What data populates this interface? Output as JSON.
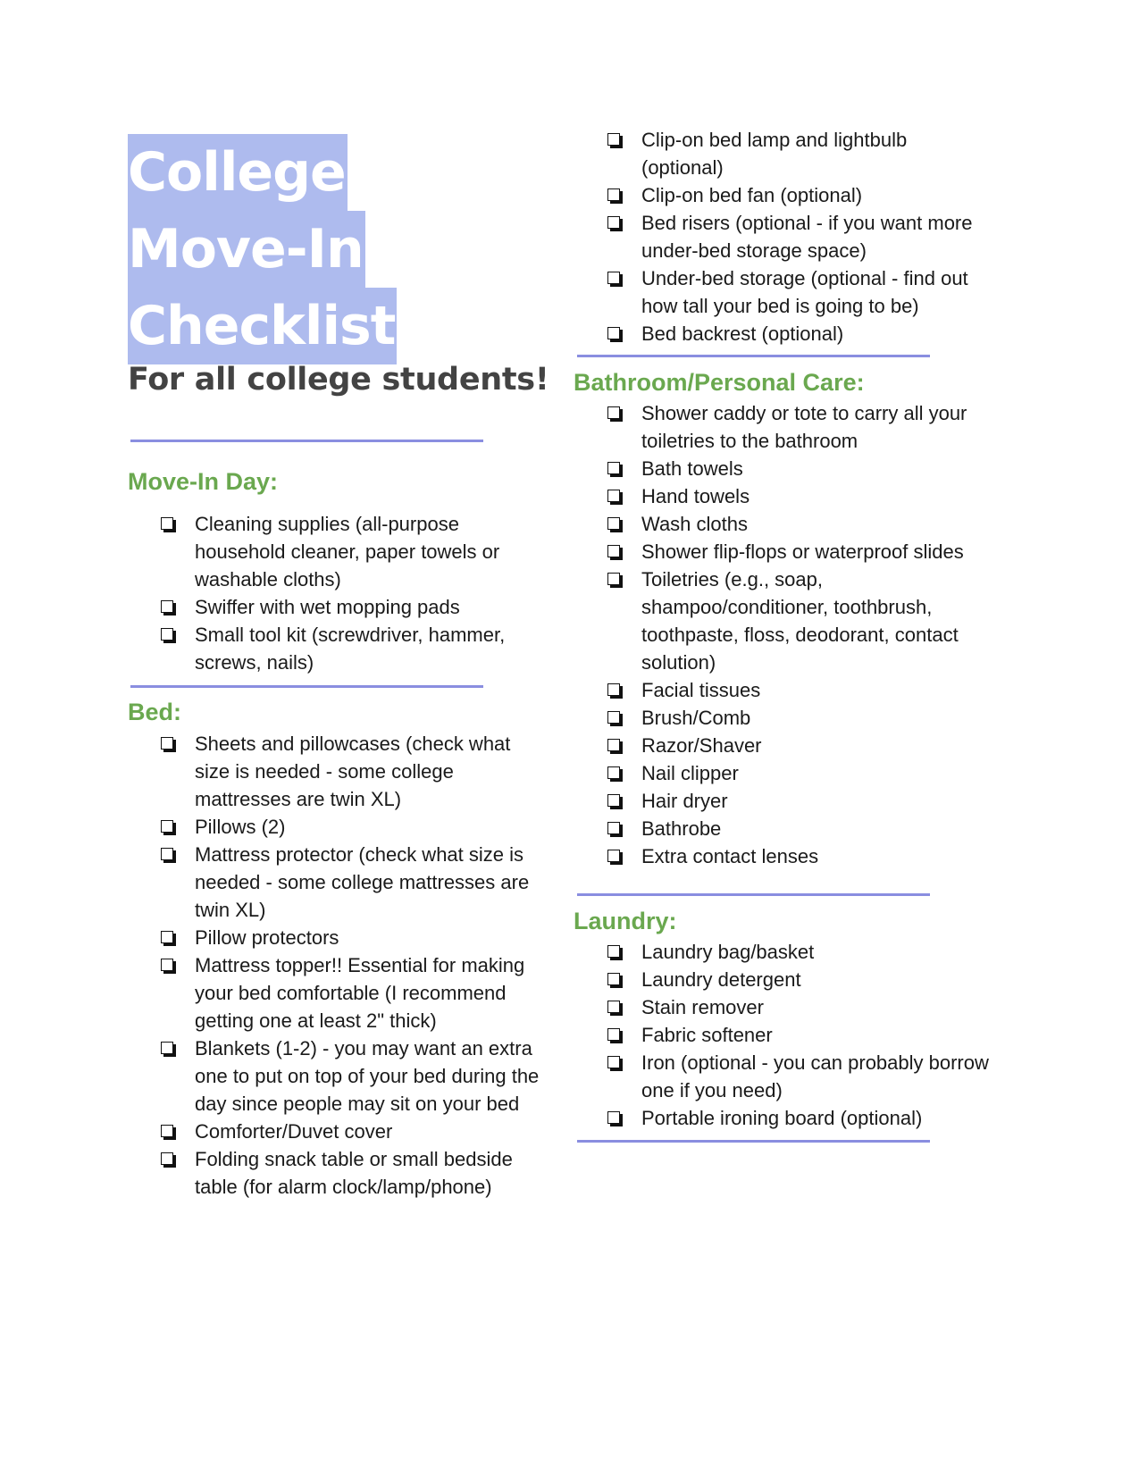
{
  "title": {
    "lines": [
      "College",
      "Move-In",
      "Checklist"
    ],
    "subtitle": "For all college students!"
  },
  "colors": {
    "heading": "#6aa84f",
    "title_highlight": "#aebbee",
    "divider": "#8a8ee0"
  },
  "icons": {
    "bullet": "checkbox-icon"
  },
  "sections": {
    "move_in": {
      "heading": "Move-In Day:",
      "items": [
        "Cleaning supplies (all-purpose household cleaner, paper towels or washable cloths)",
        "Swiffer with wet mopping pads",
        "Small tool kit (screwdriver, hammer, screws, nails)"
      ]
    },
    "bed": {
      "heading": "Bed:",
      "items": [
        "Sheets and pillowcases (check what size is needed - some college mattresses are twin XL)",
        "Pillows (2)",
        "Mattress protector (check what size is needed - some college mattresses are twin XL)",
        "Pillow protectors",
        "Mattress topper!! Essential for making your bed comfortable (I recommend getting one at least 2\" thick)",
        "Blankets (1-2) - you may want an extra one to put on top of your bed during the day since people may sit on your bed",
        "Comforter/Duvet cover",
        "Folding snack table or small bedside table (for alarm clock/lamp/phone)"
      ]
    },
    "bed_continued": {
      "items": [
        "Clip-on bed lamp and lightbulb (optional)",
        "Clip-on bed fan (optional)",
        "Bed risers (optional - if you want more under-bed storage space)",
        "Under-bed storage (optional - find out how tall your bed is going to be)",
        "Bed backrest (optional)"
      ]
    },
    "bathroom": {
      "heading": "Bathroom/Personal Care:",
      "items": [
        "Shower caddy or tote to carry all your toiletries to the bathroom",
        "Bath towels",
        "Hand towels",
        "Wash cloths",
        "Shower flip-flops or waterproof slides",
        "Toiletries (e.g., soap, shampoo/conditioner, toothbrush, toothpaste, floss, deodorant, contact solution)",
        "Facial tissues",
        "Brush/Comb",
        "Razor/Shaver",
        "Nail clipper",
        "Hair dryer",
        "Bathrobe",
        "Extra contact lenses"
      ]
    },
    "laundry": {
      "heading": "Laundry:",
      "items": [
        "Laundry bag/basket",
        "Laundry detergent",
        "Stain remover",
        "Fabric softener",
        "Iron (optional - you can probably borrow one if you need)",
        "Portable ironing board (optional)"
      ]
    }
  }
}
